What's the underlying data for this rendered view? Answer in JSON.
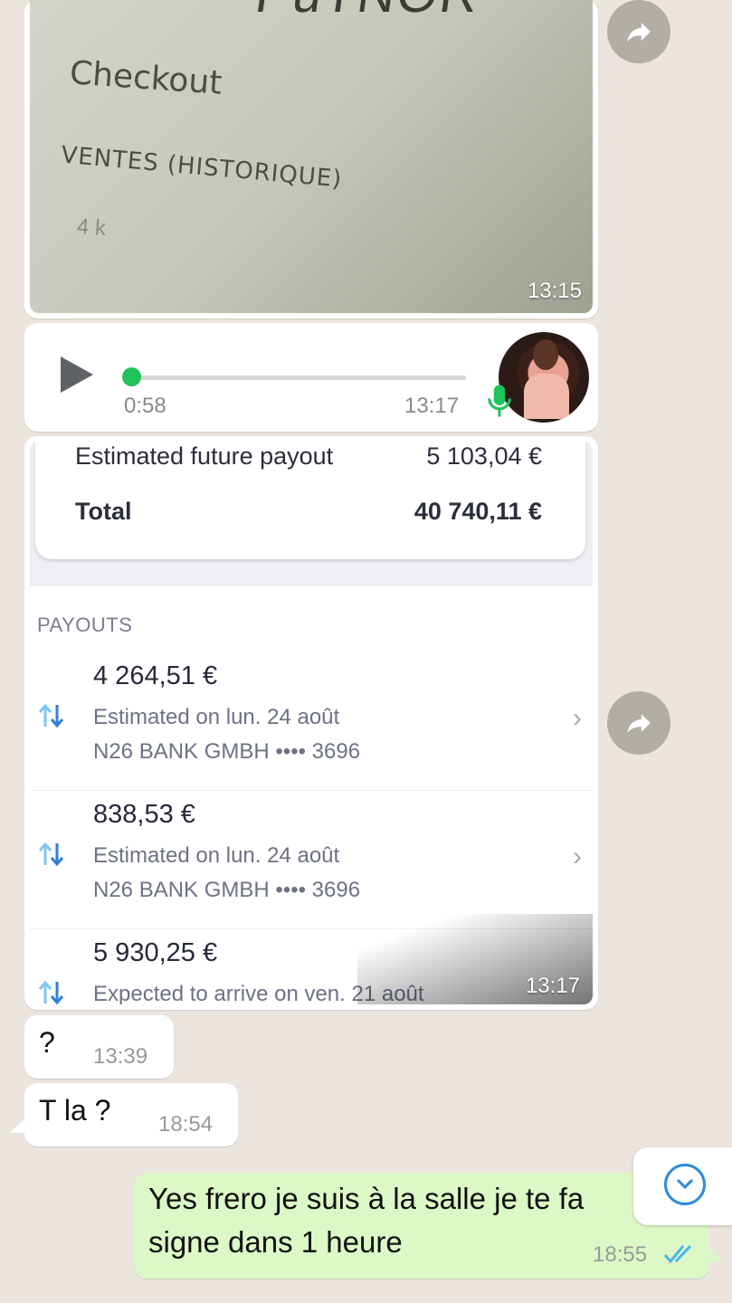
{
  "photo_message": {
    "text_big": "PuTNOR",
    "text_checkout": "Checkout",
    "text_ventes": "VENTES (HISTORIQUE)",
    "text_value": "4 k",
    "time": "13:15"
  },
  "voice_message": {
    "duration": "0:58",
    "time": "13:17"
  },
  "screenshot_message": {
    "summary": {
      "estimated_label": "Estimated future payout",
      "estimated_value": "5 103,04 €",
      "total_label": "Total",
      "total_value": "40 740,11 €"
    },
    "payouts_heading": "PAYOUTS",
    "payouts": [
      {
        "amount": "4 264,51 €",
        "line1": "Estimated on lun. 24 août",
        "line2": "N26 BANK GMBH •••• 3696"
      },
      {
        "amount": "838,53 €",
        "line1": "Estimated on lun. 24 août",
        "line2": "N26 BANK GMBH •••• 3696"
      },
      {
        "amount": "5 930,25 €",
        "line1": "Expected to arrive on ven. 21 août",
        "line2": ""
      }
    ],
    "time": "13:17"
  },
  "messages": [
    {
      "text": "?",
      "time": "13:39",
      "direction": "in"
    },
    {
      "text": "T la ?",
      "time": "18:54",
      "direction": "in"
    },
    {
      "text_line1": "Yes frero je suis à la salle je te fa",
      "text_line2": "signe dans 1 heure",
      "time": "18:55",
      "direction": "out",
      "status": "read"
    }
  ],
  "colors": {
    "background": "#ece5dd",
    "incoming": "#ffffff",
    "outgoing": "#dcf8c6",
    "read_ticks": "#4fb6ec",
    "accent_green": "#20c35a"
  },
  "icons": [
    "forward-icon",
    "play-icon",
    "mic-icon",
    "payout-arrows-icon",
    "chevron-right-icon",
    "read-ticks-icon",
    "scroll-down-icon"
  ]
}
